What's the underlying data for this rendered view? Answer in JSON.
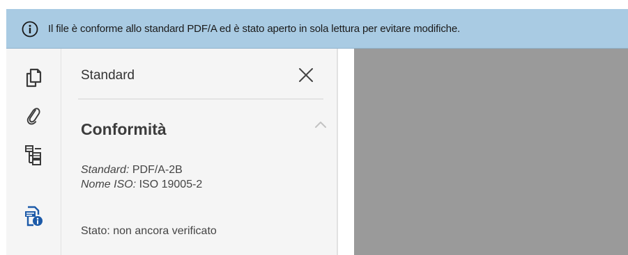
{
  "notification": {
    "icon": "info-icon",
    "message": "Il file è conforme allo standard PDF/A ed è stato aperto in sola lettura per evitare modifiche."
  },
  "rail": {
    "items": [
      {
        "name": "pages",
        "icon": "page-thumbnails-icon"
      },
      {
        "name": "attachments",
        "icon": "paperclip-icon"
      },
      {
        "name": "bookmarks",
        "icon": "structure-tree-icon"
      },
      {
        "name": "standards",
        "icon": "standards-info-icon",
        "active": true
      }
    ]
  },
  "panel": {
    "title": "Standard",
    "close_icon": "close-icon",
    "section": {
      "title": "Conformità",
      "collapse_icon": "chevron-up-icon",
      "standard_label": "Standard:",
      "standard_value": " PDF/A-2B",
      "iso_label": "Nome ISO:",
      "iso_value": " ISO 19005-2",
      "status": "Stato: non ancora verificato"
    }
  },
  "colors": {
    "infobar": "#a9cbe3",
    "accent": "#1c5aa8",
    "panel_bg": "#f5f5f5",
    "doc_bg": "#9a9a9a"
  }
}
